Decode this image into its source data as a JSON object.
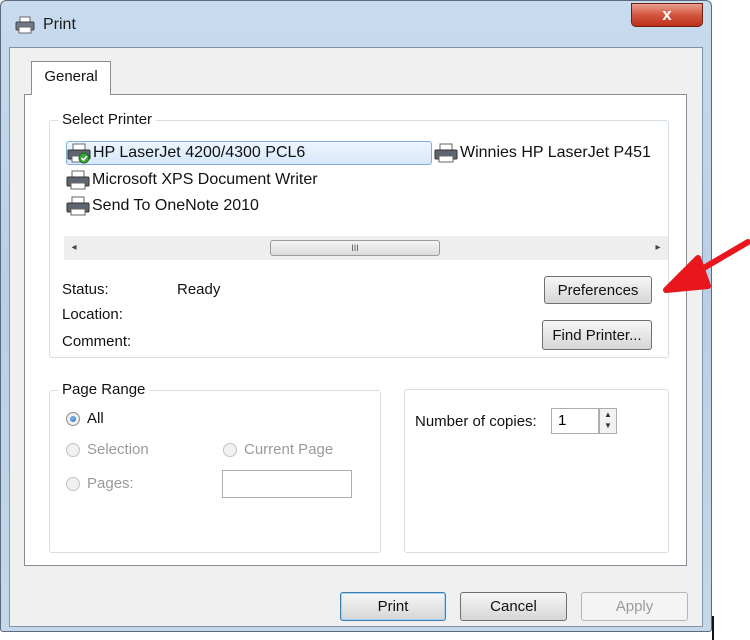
{
  "window": {
    "title": "Print",
    "close_glyph": "x"
  },
  "tabs": [
    {
      "label": "General"
    }
  ],
  "select_printer": {
    "label": "Select Printer",
    "printers": [
      {
        "name": "HP LaserJet 4200/4300 PCL6",
        "selected": true,
        "default": true
      },
      {
        "name": "Winnies HP LaserJet P451",
        "selected": false
      },
      {
        "name": "Microsoft XPS Document Writer",
        "selected": false
      },
      {
        "name": "Send To OneNote 2010",
        "selected": false
      }
    ],
    "scroll": {
      "left_glyph": "◂",
      "right_glyph": "▸",
      "thumb_glyph": "III"
    },
    "status_label": "Status:",
    "status_value": "Ready",
    "location_label": "Location:",
    "comment_label": "Comment:",
    "preferences_button": "Preferences",
    "find_printer_button": "Find Printer..."
  },
  "page_range": {
    "label": "Page Range",
    "all": "All",
    "selection": "Selection",
    "current_page": "Current Page",
    "pages": "Pages:",
    "pages_value": "",
    "selected": "all"
  },
  "copies": {
    "label": "Number of copies:",
    "value": "1",
    "up_glyph": "▲",
    "down_glyph": "▼"
  },
  "buttons": {
    "print": "Print",
    "cancel": "Cancel",
    "apply": "Apply"
  },
  "colors": {
    "annotation_arrow": "#e8161d"
  }
}
